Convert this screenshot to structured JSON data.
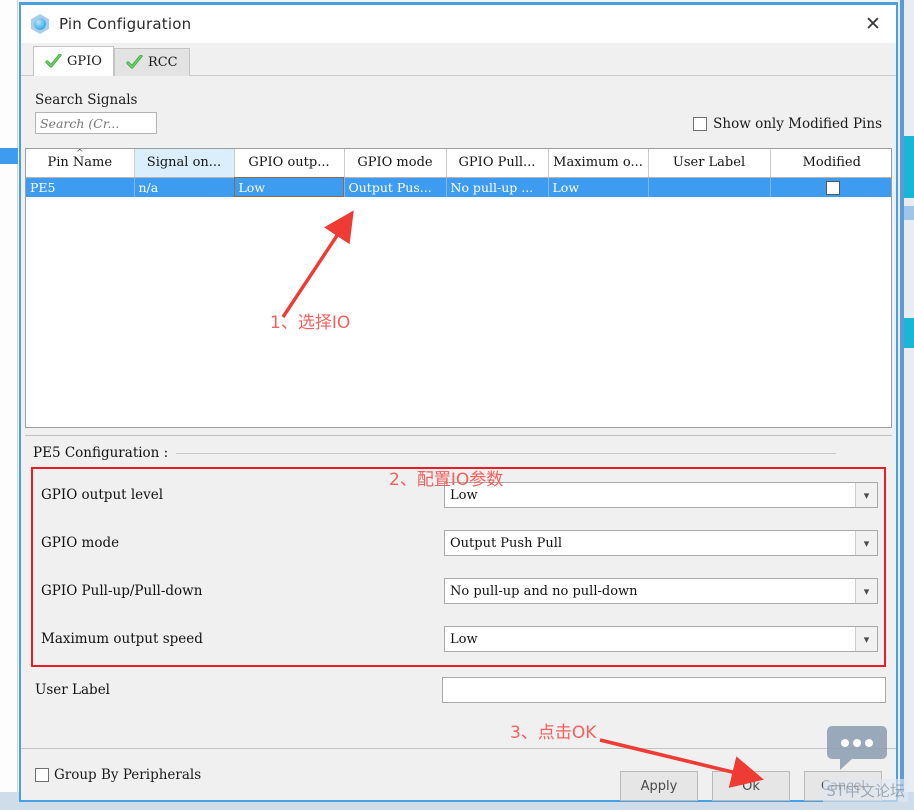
{
  "window": {
    "title": "Pin Configuration",
    "icon": "cube-icon",
    "close_label": "✕"
  },
  "tabs": [
    {
      "label": "GPIO",
      "icon": "check-icon",
      "active": true
    },
    {
      "label": "RCC",
      "icon": "check-icon",
      "active": false
    }
  ],
  "search": {
    "label": "Search Signals",
    "placeholder": "Search (Cr...",
    "value": ""
  },
  "show_only_modified": {
    "label": "Show only Modified Pins",
    "checked": false
  },
  "table": {
    "columns": [
      "Pin Name",
      "Signal on...",
      "GPIO outp...",
      "GPIO mode",
      "GPIO Pull...",
      "Maximum o...",
      "User Label",
      "Modified"
    ],
    "rows": [
      {
        "pin_name": "PE5",
        "signal_on": "n/a",
        "gpio_output": "Low",
        "gpio_mode": "Output Pus...",
        "gpio_pull": "No pull-up ...",
        "maximum_output": "Low",
        "user_label": "",
        "modified": false,
        "selected": true
      }
    ]
  },
  "configuration": {
    "title": "PE5 Configuration :",
    "fields": [
      {
        "label": "GPIO output level",
        "value": "Low"
      },
      {
        "label": "GPIO mode",
        "value": "Output Push Pull"
      },
      {
        "label": "GPIO Pull-up/Pull-down",
        "value": "No pull-up and no pull-down"
      },
      {
        "label": "Maximum output speed",
        "value": "Low"
      }
    ],
    "user_label": {
      "label": "User Label",
      "value": ""
    }
  },
  "footer": {
    "group_by_peripherals": {
      "label": "Group By Peripherals",
      "checked": false
    },
    "buttons": [
      {
        "label": "Apply"
      },
      {
        "label": "Ok"
      },
      {
        "label": "Cancel"
      }
    ]
  },
  "annotations": [
    {
      "text": "1、选择IO"
    },
    {
      "text": "2、配置IO参数"
    },
    {
      "text": "3、点击OK"
    }
  ],
  "watermark": {
    "text": "ST中文论坛",
    "icon": "chat-bubble-icon"
  },
  "colors": {
    "accent_blue": "#3d9bf0",
    "annotation_red": "#f0504a",
    "border_blue": "#4a9fe0",
    "header_highlight": "#dbeefb"
  }
}
